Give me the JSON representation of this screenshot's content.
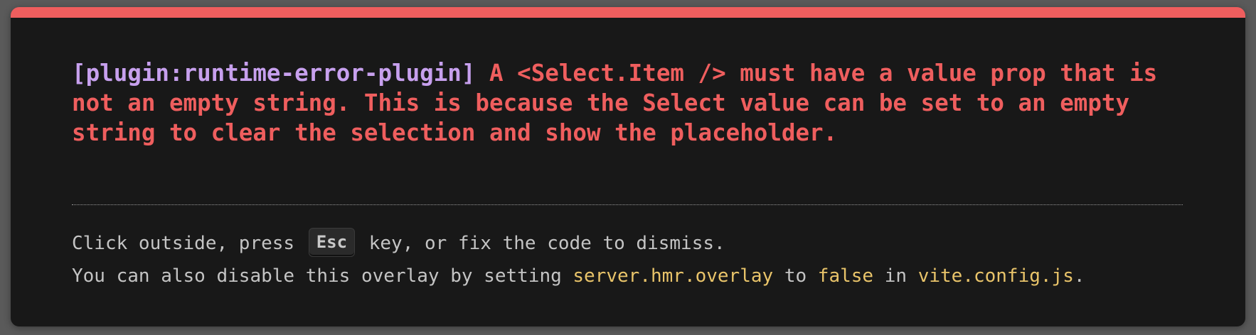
{
  "colors": {
    "accent_error": "#ef5e5e",
    "plugin_tag": "#c7a0ee",
    "code_highlight": "#e9c46a",
    "background": "#181818",
    "text_muted": "#c4c4c4"
  },
  "error": {
    "plugin": "[plugin:runtime-error-plugin]",
    "message": "A <Select.Item /> must have a value prop that is not an empty string. This is because the Select value can be set to an empty string to clear the selection and show the placeholder."
  },
  "tip": {
    "line1": {
      "before": "Click outside, press ",
      "key": "Esc",
      "after": " key, or fix the code to dismiss."
    },
    "line2": {
      "before": "You can also disable this overlay by setting ",
      "code1": "server.hmr.overlay",
      "mid1": " to ",
      "code2": "false",
      "mid2": " in ",
      "code3": "vite.config.js",
      "after": "."
    }
  }
}
